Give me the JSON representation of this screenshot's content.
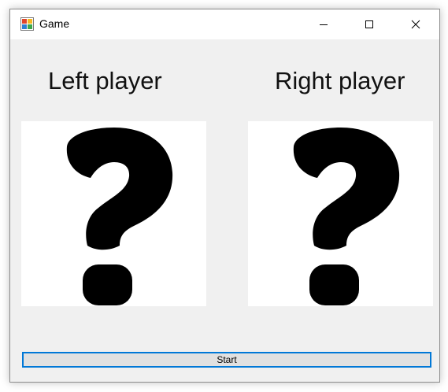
{
  "window": {
    "title": "Game",
    "icon": "windows-forms-app-icon"
  },
  "caption_buttons": {
    "minimize_icon": "minimize-icon",
    "maximize_icon": "maximize-icon",
    "close_icon": "close-icon"
  },
  "players": {
    "left": {
      "label": "Left player",
      "card_icon": "question-mark-icon"
    },
    "right": {
      "label": "Right player",
      "card_icon": "question-mark-icon"
    }
  },
  "actions": {
    "start_label": "Start"
  },
  "colors": {
    "window_bg": "#f0f0f0",
    "titlebar_bg": "#ffffff",
    "card_bg": "#ffffff",
    "accent_focus": "#0078d7",
    "button_bg": "#e1e1e1"
  }
}
